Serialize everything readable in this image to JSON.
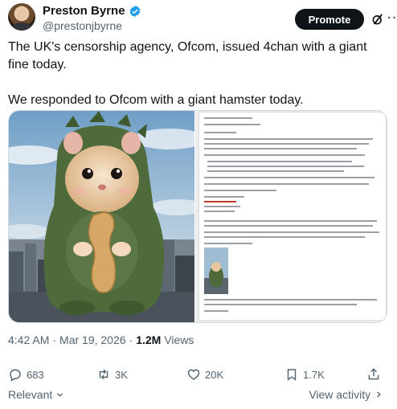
{
  "author": {
    "name": "Preston Byrne",
    "handle": "@prestonjbyrne"
  },
  "header": {
    "promote_label": "Promote",
    "more_label": "···"
  },
  "tweet": {
    "paragraph1": "The UK's censorship agency, Ofcom, issued 4chan with a giant fine today.",
    "paragraph2": "We responded to Ofcom with a giant hamster today."
  },
  "meta": {
    "time": "4:42 AM",
    "separator": "·",
    "date": "Mar 19, 2026",
    "views_count": "1.2M",
    "views_label": "Views"
  },
  "actions": {
    "replies": "683",
    "reposts": "3K",
    "likes": "20K",
    "bookmarks": "1.7K"
  },
  "footer": {
    "relevant_label": "Relevant",
    "view_activity_label": "View activity"
  },
  "colors": {
    "verified": "#1d9bf0",
    "text_primary": "#0f1419",
    "text_secondary": "#536471"
  }
}
